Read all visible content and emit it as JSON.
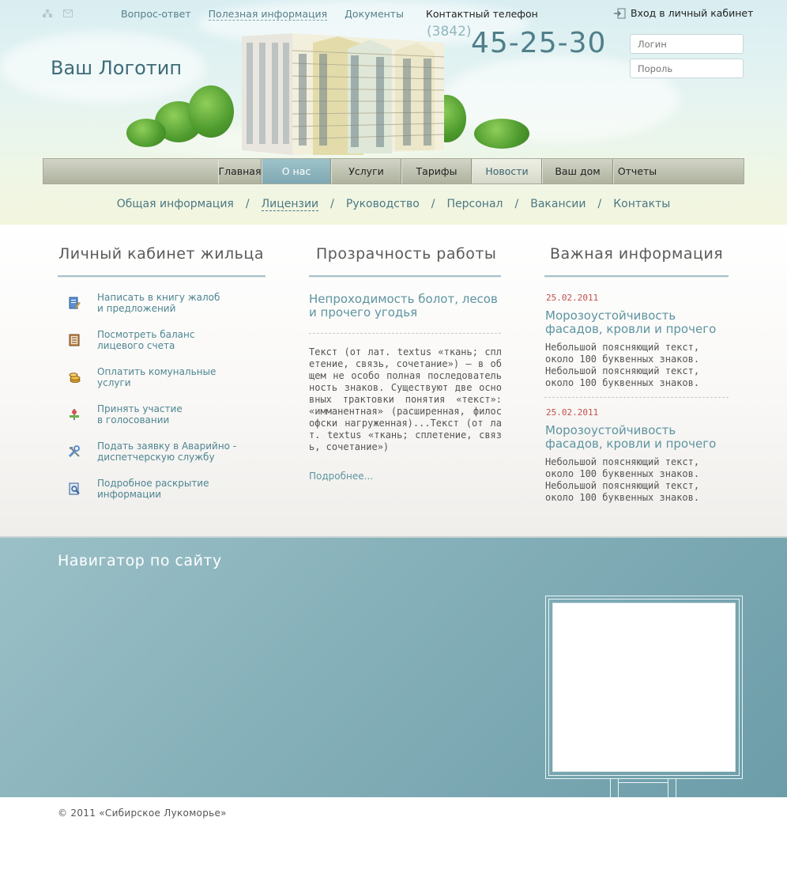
{
  "header": {
    "top_links": [
      "Вопрос-ответ",
      "Полезная информация",
      "Документы"
    ],
    "phone_label": "Контактный телефон",
    "phone_code": "(3842)",
    "phone_number": "45-25-30",
    "login_link": "Вход в личный кабинет",
    "login_placeholder": "Логин",
    "password_placeholder": "Пороль",
    "logo": "Ваш Логотип"
  },
  "main_nav": [
    "Главная",
    "О нас",
    "Услуги",
    "Тарифы",
    "Новости",
    "Ваш дом",
    "Отчеты"
  ],
  "sub_nav": [
    "Общая информация",
    "Лицензии",
    "Руководство",
    "Персонал",
    "Вакансии",
    "Контакты"
  ],
  "cabinet": {
    "title": "Личный кабинет жильца",
    "items": [
      {
        "label": "Написать в книгу жалоб\nи предложений",
        "icon": "book-pencil-icon"
      },
      {
        "label": "Посмотреть баланс\nлицевого счета",
        "icon": "ledger-icon"
      },
      {
        "label": "Оплатить комунальные\nуслуги",
        "icon": "coins-icon"
      },
      {
        "label": "Принять участие\nв голосовании",
        "icon": "vote-icon"
      },
      {
        "label": "Подать заявку в Аварийно -\nдиспетчерскую службу",
        "icon": "tools-icon"
      },
      {
        "label": "Подробное раскрытие\nинформации",
        "icon": "document-search-icon"
      }
    ]
  },
  "transparency": {
    "title": "Прозрачность работы",
    "headline": "Непроходимость болот, лесов и прочего угодья",
    "body": "  Текст (от лат. textus «ткань; сплетение, связь, сочетание») — в общем не особо полная последовательность знаков. Существуют две основных трактовки понятия «текст»: «имманентная» (расширенная, философски нагруженная)...Текст (от лат. textus «ткань; сплетение, связь, сочетание»)",
    "more": "Подробнее..."
  },
  "important": {
    "title": "Важная информация",
    "items": [
      {
        "date": "25.02.2011",
        "title": "Морозоустойчивость фасадов, кровли и прочего",
        "text": "Небольшой поясняющий текст,\nоколо 100 буквенных знаков.\nНебольшой поясняющий текст,\nоколо 100 буквенных знаков."
      },
      {
        "date": "25.02.2011",
        "title": "Морозоустойчивость фасадов, кровли и прочего",
        "text": "Небольшой поясняющий текст,\nоколо 100 буквенных знаков.\nНебольшой поясняющий текст,\nоколо 100 буквенных знаков."
      }
    ]
  },
  "navigator": {
    "title": "Навигатор по сайту"
  },
  "footer": {
    "copyright": "© 2011 «Сибирское Лукоморье»"
  },
  "colors": {
    "accent": "#5d94a0",
    "active_tab": "#8fb6bf",
    "date": "#c0504d",
    "navigator_bg": "#87b1ba"
  }
}
